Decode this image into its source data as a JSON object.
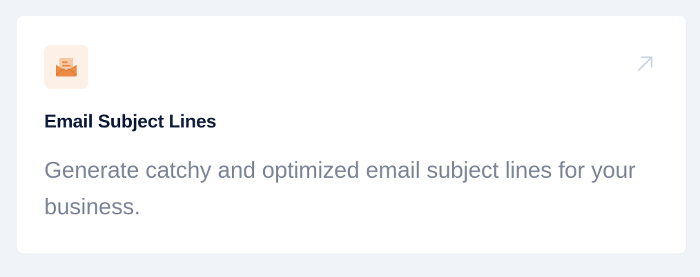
{
  "card": {
    "title": "Email Subject Lines",
    "description": "Generate catchy and optimized email subject lines for your business.",
    "icon": "envelope-open-icon",
    "action_icon": "arrow-up-right-icon"
  },
  "colors": {
    "page_background": "#f0f3f7",
    "card_background": "#ffffff",
    "icon_tile_background": "#fdf0e6",
    "icon_orange": "#ec8a47",
    "title": "#0f1d3a",
    "description": "#7c8496",
    "arrow": "#cdd5e2"
  }
}
